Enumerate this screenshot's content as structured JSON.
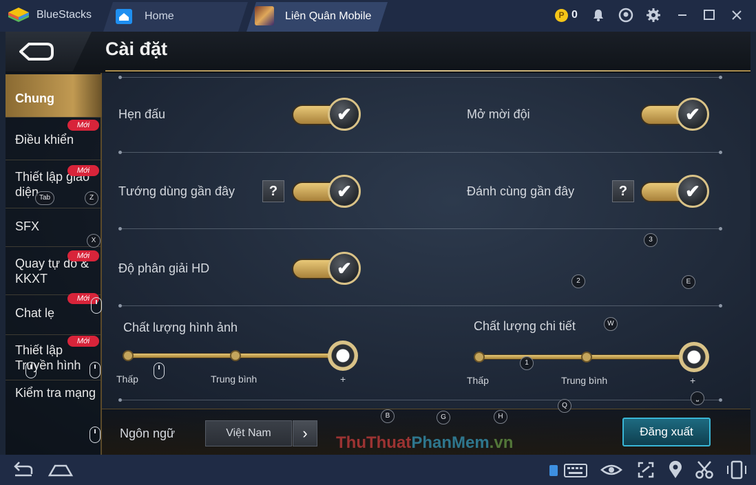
{
  "titlebar": {
    "app_name": "BlueStacks",
    "tabs": [
      {
        "label": "Home",
        "icon": "home-icon"
      },
      {
        "label": "Liên Quân Mobile",
        "icon": "game-icon"
      }
    ],
    "coin_symbol": "P",
    "coin_count": "0",
    "icons": [
      "bell-icon",
      "account-icon",
      "gear-icon",
      "minimize-icon",
      "maximize-icon",
      "close-icon"
    ]
  },
  "game": {
    "title": "Cài đặt",
    "sidebar": [
      {
        "label": "Chung",
        "badge": ""
      },
      {
        "label": "Điều khiển",
        "badge": "Mới"
      },
      {
        "label": "Thiết lập giao diện",
        "badge": "Mới"
      },
      {
        "label": "SFX",
        "badge": ""
      },
      {
        "label": "Quay tự do & KKXT",
        "badge": "Mới"
      },
      {
        "label": "Chat lẹ",
        "badge": "Mới"
      },
      {
        "label": "Thiết lập Truyền hình",
        "badge": "Mới"
      },
      {
        "label": "Kiểm tra mạng",
        "badge": ""
      }
    ],
    "toggles": [
      {
        "label": "Hẹn đấu",
        "on": true,
        "help": ""
      },
      {
        "label": "Mở mời đội",
        "on": true,
        "help": ""
      },
      {
        "label": "Tướng dùng gần đây",
        "on": true,
        "help": "?"
      },
      {
        "label": "Đánh cùng gần đây",
        "on": true,
        "help": "?"
      },
      {
        "label": "Độ phân giải HD",
        "on": true,
        "help": ""
      }
    ],
    "check_glyph": "✔",
    "sliders": [
      {
        "label": "Chất lượng hình ảnh",
        "ticks": [
          "Thấp",
          "Trung bình",
          "+"
        ],
        "level": 1.0
      },
      {
        "label": "Chất lượng chi tiết",
        "ticks": [
          "Thấp",
          "Trung bình",
          "+"
        ],
        "level": 1.0
      }
    ],
    "language": {
      "label": "Ngôn ngữ",
      "value": "Việt Nam",
      "next_glyph": "›"
    },
    "logout_label": "Đăng xuất",
    "key_hints": [
      "Tab",
      "Z",
      "X",
      "3",
      "2",
      "E",
      "W",
      "1",
      "B",
      "G",
      "H",
      "Q",
      "⎵"
    ]
  },
  "watermark": {
    "part1": "ThuThuat",
    "part2": "PhanMem",
    "part3": ".vn"
  },
  "navbar": {
    "icons": [
      "back-icon",
      "home-icon",
      "keyboard-icon",
      "eye-icon",
      "fullscreen-icon",
      "location-icon",
      "scissors-icon",
      "rotate-icon"
    ]
  }
}
